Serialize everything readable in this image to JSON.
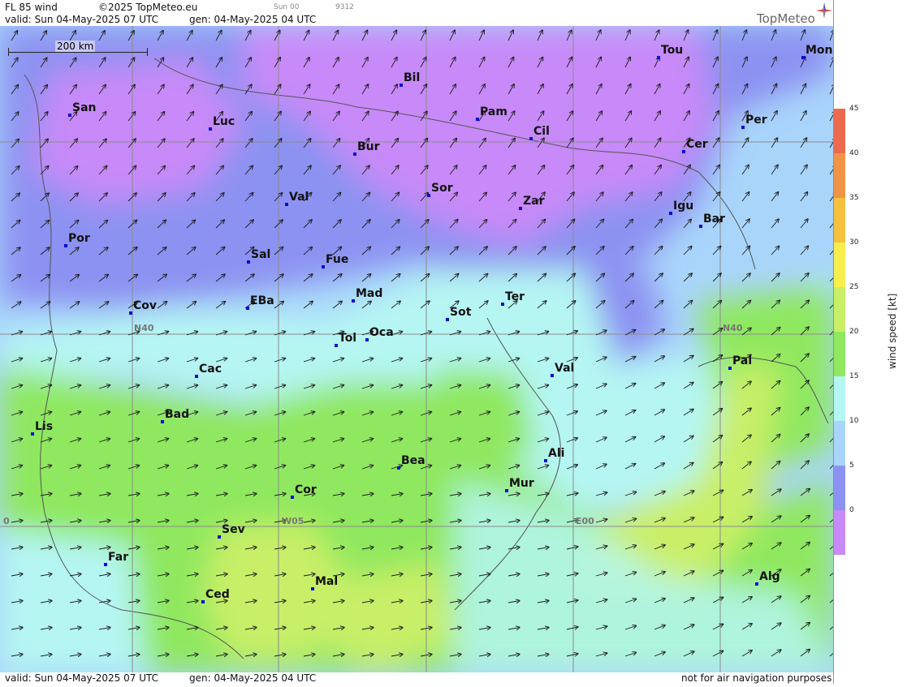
{
  "header": {
    "product": "FL 85 wind",
    "copyright": "©2025 TopMeteo.eu",
    "run": "Sun 00",
    "code": "9312",
    "valid": "valid:  Sun  04-May-2025  07 UTC",
    "gen": "gen: 04-May-2025 04 UTC"
  },
  "logo": "TopMeteo",
  "scale_label": "200 km",
  "footer": {
    "valid": "valid:  Sun  04-May-2025  07 UTC",
    "gen": "gen: 04-May-2025 04 UTC",
    "note": "not for air navigation purposes"
  },
  "legend": {
    "title": "wind speed [kt]",
    "ticks": [
      "45",
      "40",
      "35",
      "30",
      "25",
      "20",
      "15",
      "10",
      "5",
      "0"
    ],
    "colors": [
      "#ec6b4e",
      "#f09448",
      "#f5c13f",
      "#f8ef4e",
      "#c9ef67",
      "#8fe85f",
      "#b5f6f3",
      "#a9d5fb",
      "#8c92f1",
      "#c78af8"
    ]
  },
  "grid_labels": [
    "N40",
    "N40",
    "W05",
    "E00",
    "0"
  ],
  "cities": [
    "Tou",
    "Mon",
    "Bil",
    "San",
    "Luc",
    "Pam",
    "Cil",
    "Per",
    "Cer",
    "Bur",
    "Sor",
    "Val",
    "Zar",
    "Igu",
    "Bar",
    "Por",
    "Sal",
    "Fue",
    "Mad",
    "EBa",
    "Cov",
    "Sot",
    "Ter",
    "Tol",
    "Oca",
    "Cac",
    "Pal",
    "Val",
    "Bad",
    "Lis",
    "Ali",
    "Bea",
    "Cor",
    "Mur",
    "Sev",
    "Far",
    "Mal",
    "Ced",
    "Alg"
  ]
}
